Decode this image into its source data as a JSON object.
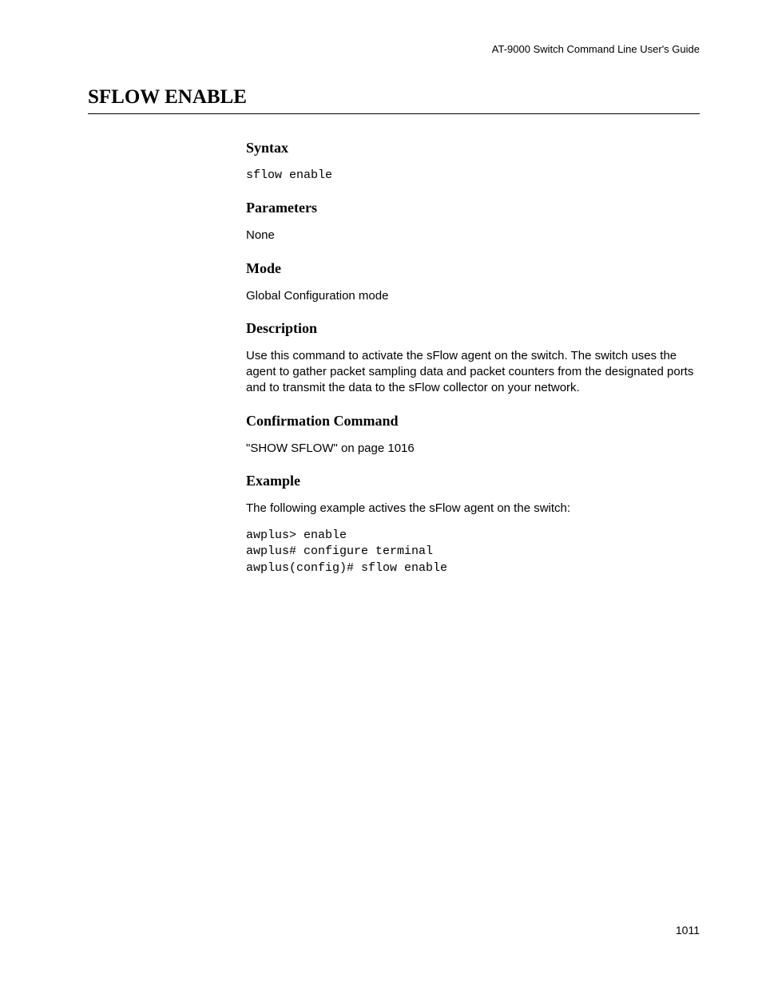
{
  "header": {
    "guide_title": "AT-9000 Switch Command Line User's Guide"
  },
  "page": {
    "title": "SFLOW ENABLE",
    "number": "1011"
  },
  "sections": {
    "syntax": {
      "heading": "Syntax",
      "code": "sflow enable"
    },
    "parameters": {
      "heading": "Parameters",
      "text": "None"
    },
    "mode": {
      "heading": "Mode",
      "text": "Global Configuration mode"
    },
    "description": {
      "heading": "Description",
      "text": "Use this command to activate the sFlow agent on the switch. The switch uses the agent to gather packet sampling data and packet counters from the designated ports and to transmit the data to the sFlow collector on your network."
    },
    "confirmation": {
      "heading": "Confirmation Command",
      "text": "\"SHOW SFLOW\" on page 1016"
    },
    "example": {
      "heading": "Example",
      "intro": "The following example actives the sFlow agent on the switch:",
      "code": "awplus> enable\nawplus# configure terminal\nawplus(config)# sflow enable"
    }
  }
}
